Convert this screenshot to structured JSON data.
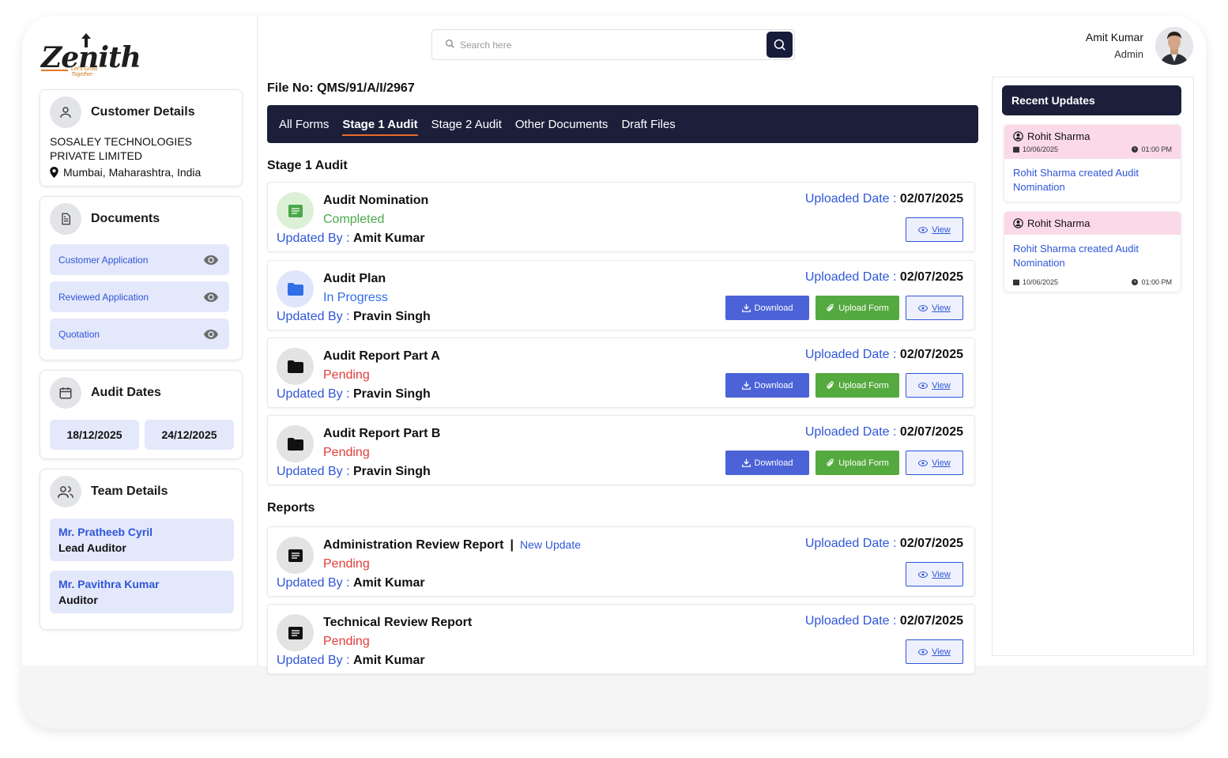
{
  "brand": {
    "name": "Zenith",
    "tagline": "Let's Grow Together"
  },
  "search": {
    "placeholder": "Search here"
  },
  "user": {
    "name": "Amit Kumar",
    "role": "Admin"
  },
  "customer": {
    "title": "Customer Details",
    "name": "SOSALEY TECHNOLOGIES PRIVATE LIMITED",
    "location": "Mumbai, Maharashtra, India"
  },
  "documents": {
    "title": "Documents",
    "items": [
      {
        "label": "Customer Application"
      },
      {
        "label": "Reviewed Application"
      },
      {
        "label": "Quotation"
      }
    ]
  },
  "audit_dates": {
    "title": "Audit Dates",
    "start": "18/12/2025",
    "end": "24/12/2025"
  },
  "team": {
    "title": "Team Details",
    "members": [
      {
        "name": "Mr. Pratheeb Cyril",
        "role": "Lead Auditor"
      },
      {
        "name": "Mr. Pavithra Kumar",
        "role": "Auditor"
      }
    ]
  },
  "file_no": "File No: QMS/91/A/I/2967",
  "tabs": [
    "All Forms",
    "Stage 1 Audit",
    "Stage 2 Audit",
    "Other Documents",
    "Draft Files"
  ],
  "labels": {
    "updated_by": "Updated By :",
    "uploaded_date": "Uploaded Date :",
    "download": "Download",
    "upload_form": "Upload Form",
    "view": "View"
  },
  "stage1": {
    "title": "Stage 1 Audit",
    "rows": [
      {
        "title": "Audit Nomination",
        "status": "Completed",
        "updated_by": "Amit Kumar",
        "date": "02/07/2025"
      },
      {
        "title": "Audit Plan",
        "status": "In Progress",
        "updated_by": "Pravin Singh",
        "date": "02/07/2025"
      },
      {
        "title": "Audit Report Part A",
        "status": "Pending",
        "updated_by": "Pravin Singh",
        "date": "02/07/2025"
      },
      {
        "title": "Audit Report Part B",
        "status": "Pending",
        "updated_by": "Pravin Singh",
        "date": "02/07/2025"
      }
    ]
  },
  "reports": {
    "title": "Reports",
    "rows": [
      {
        "title": "Administration Review Report",
        "sep": "|",
        "badge": "New Update",
        "status": "Pending",
        "updated_by": "Amit Kumar",
        "date": "02/07/2025"
      },
      {
        "title": "Technical Review Report",
        "status": "Pending",
        "updated_by": "Amit Kumar",
        "date": "02/07/2025"
      }
    ]
  },
  "recent": {
    "title": "Recent Updates",
    "items": [
      {
        "user": "Rohit Sharma",
        "date": "10/06/2025",
        "time": "01:00 PM",
        "text": "Rohit Sharma created Audit Nomination"
      },
      {
        "user": "Rohit Sharma",
        "date": "10/06/2025",
        "time": "01:00 PM",
        "text": "Rohit Sharma created Audit Nomination"
      }
    ]
  }
}
